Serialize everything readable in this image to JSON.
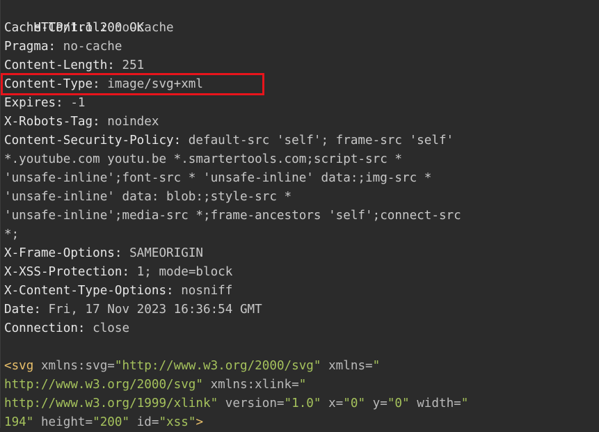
{
  "response": {
    "status_line": "HTTP/1.1 200 OK",
    "headers": [
      {
        "name": "Cache-Control:",
        "value": " no-cache"
      },
      {
        "name": "Pragma:",
        "value": " no-cache"
      },
      {
        "name": "Content-Length:",
        "value": " 251"
      },
      {
        "name": "Content-Type:",
        "value": " image/svg+xml"
      },
      {
        "name": "Expires:",
        "value": " -1"
      },
      {
        "name": "X-Robots-Tag:",
        "value": " noindex"
      },
      {
        "name": "Content-Security-Policy:",
        "value": " default-src 'self'; frame-src 'self'"
      }
    ],
    "csp_continuation": [
      "*.youtube.com youtu.be *.smartertools.com;script-src *",
      "'unsafe-inline';font-src * 'unsafe-inline' data:;img-src *",
      "'unsafe-inline' data: blob:;style-src *",
      "'unsafe-inline';media-src *;frame-ancestors 'self';connect-src",
      "*;"
    ],
    "headers_after": [
      {
        "name": "X-Frame-Options:",
        "value": " SAMEORIGIN"
      },
      {
        "name": "X-XSS-Protection:",
        "value": " 1; mode=block"
      },
      {
        "name": "X-Content-Type-Options:",
        "value": " nosniff"
      },
      {
        "name": "Date:",
        "value": " Fri, 17 Nov 2023 16:36:54 GMT"
      },
      {
        "name": "Connection:",
        "value": " close"
      }
    ],
    "body": {
      "l1": {
        "open": "<svg",
        "a1": " xmlns:svg=",
        "v1": "\"http://www.w3.org/2000/svg\"",
        "a2": " xmlns=",
        "v2": "\""
      },
      "l2": {
        "v1": "http://www.w3.org/2000/svg\"",
        "a1": " xmlns:xlink=",
        "v2": "\""
      },
      "l3": {
        "v1": "http://www.w3.org/1999/xlink\"",
        "a1": " version=",
        "v2": "\"1.0\"",
        "a2": " x=",
        "v3": "\"0\"",
        "a3": " y=",
        "v4": "\"0\"",
        "a4": " width=",
        "v5": "\""
      },
      "l4": {
        "v1": "194\"",
        "a1": " height=",
        "v2": "\"200\"",
        "a2": " id=",
        "v3": "\"xss\"",
        "close": ">"
      }
    }
  },
  "highlight": {
    "color": "#e8141b",
    "target": "Content-Type"
  }
}
